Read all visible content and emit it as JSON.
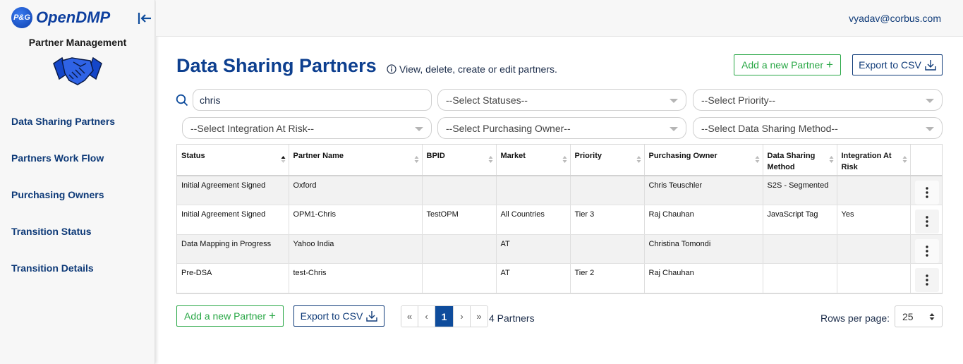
{
  "brand": {
    "logo_text": "P&G",
    "name": "OpenDMP"
  },
  "sidebar": {
    "section_title": "Partner Management",
    "items": [
      {
        "label": "Data Sharing Partners"
      },
      {
        "label": "Partners Work Flow"
      },
      {
        "label": "Purchasing Owners"
      },
      {
        "label": "Transition Status"
      },
      {
        "label": "Transition Details"
      }
    ]
  },
  "header": {
    "user_email": "vyadav@corbus.com"
  },
  "page": {
    "title": "Data Sharing Partners",
    "subtitle": "View, delete, create or edit partners."
  },
  "actions": {
    "add_partner": "Add a new Partner",
    "export_csv": "Export to CSV"
  },
  "filters": {
    "search_value": "chris",
    "statuses": "--Select Statuses--",
    "priority": "--Select Priority--",
    "integration_at_risk": "--Select Integration At Risk--",
    "purchasing_owner": "--Select Purchasing Owner--",
    "data_sharing_method": "--Select Data Sharing Method--"
  },
  "table": {
    "columns": [
      "Status",
      "Partner Name",
      "BPID",
      "Market",
      "Priority",
      "Purchasing Owner",
      "Data Sharing Method",
      "Integration At Risk"
    ],
    "sorted_column": "Status",
    "sort_direction": "ascending",
    "rows": [
      [
        "Initial Agreement Signed",
        "Oxford",
        "",
        "",
        "",
        "Chris Teuschler",
        "S2S - Segmented",
        ""
      ],
      [
        "Initial Agreement Signed",
        "OPM1-Chris",
        "TestOPM",
        "All Countries",
        "Tier 3",
        "Raj Chauhan",
        "JavaScript Tag",
        "Yes"
      ],
      [
        "Data Mapping in Progress",
        "Yahoo India",
        "",
        "AT",
        "",
        "Christina Tomondi",
        "",
        ""
      ],
      [
        "Pre-DSA",
        "test-Chris",
        "",
        "AT",
        "Tier 2",
        "Raj Chauhan",
        "",
        ""
      ]
    ]
  },
  "pagination": {
    "first": "«",
    "prev": "‹",
    "current": "1",
    "next": "›",
    "last": "»",
    "count_label": "4 Partners",
    "rows_per_page_label": "Rows per page:",
    "rows_per_page": "25"
  },
  "colors": {
    "primary": "#0d3f8f",
    "success": "#28a745",
    "active_page": "#0e4c9c"
  }
}
